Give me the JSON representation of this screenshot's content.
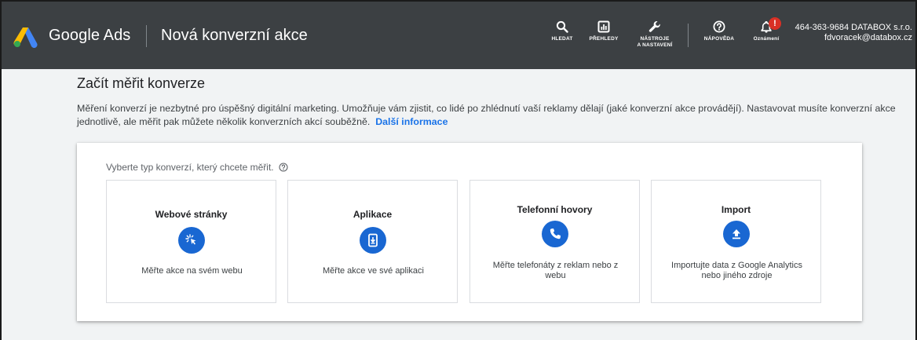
{
  "header": {
    "brand": "Google Ads",
    "page_name": "Nová konverzní akce",
    "nav": [
      {
        "label": "HLEDAT",
        "icon": "search-icon"
      },
      {
        "label": "PŘEHLEDY",
        "icon": "reports-icon"
      },
      {
        "label": "NÁSTROJE\nA NASTAVENÍ",
        "icon": "wrench-icon"
      },
      {
        "label": "NÁPOVĚDA",
        "icon": "help-icon"
      },
      {
        "label": "Oznámení",
        "icon": "bell-icon"
      }
    ],
    "notification_badge": "!",
    "account_id": "464-363-9684 DATABOX s.r.o.",
    "account_email": "fdvoracek@databox.cz"
  },
  "main": {
    "title": "Začít měřit konverze",
    "description": "Měření konverzí je nezbytné pro úspěšný digitální marketing. Umožňuje vám zjistit, co lidé po zhlédnutí vaší reklamy dělají (jaké konverzní akce provádějí). Nastavovat musíte konverzní akce jednotlivě, ale měřit pak můžete několik konverzních akcí souběžně.",
    "learn_more": "Další informace",
    "prompt": "Vyberte typ konverzí, který chcete měřit.",
    "options": [
      {
        "title": "Webové stránky",
        "description": "Měřte akce na svém webu",
        "icon": "cursor-click-icon"
      },
      {
        "title": "Aplikace",
        "description": "Měřte akce ve své aplikaci",
        "icon": "app-download-icon"
      },
      {
        "title": "Telefonní hovory",
        "description": "Měřte telefonáty z reklam nebo z webu",
        "icon": "phone-icon"
      },
      {
        "title": "Import",
        "description": "Importujte data z Google Analytics nebo jiného zdroje",
        "icon": "upload-icon"
      }
    ]
  },
  "colors": {
    "topbar": "#3c4043",
    "accent": "#1967d2",
    "link": "#1a73e8",
    "badge": "#d93025"
  }
}
